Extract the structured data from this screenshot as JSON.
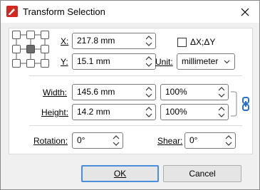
{
  "window": {
    "title": "Transform Selection"
  },
  "position": {
    "x_label": "X:",
    "x_value": "217.8 mm",
    "y_label": "Y:",
    "y_value": "15.1 mm",
    "delta_label": "ΔX;ΔY",
    "unit_label": "Unit:",
    "unit_value": "millimeter"
  },
  "size": {
    "width_label": "Width:",
    "width_value": "145.6 mm",
    "width_percent": "100%",
    "height_label": "Height:",
    "height_value": "14.2 mm",
    "height_percent": "100%"
  },
  "rotation": {
    "rotation_label": "Rotation:",
    "rotation_value": "0°",
    "shear_label": "Shear:",
    "shear_value": "0°"
  },
  "buttons": {
    "ok": "OK",
    "cancel": "Cancel"
  },
  "colors": {
    "accent": "#4a8fd8",
    "link": "#2a6fc7",
    "app_icon": "#d3281f"
  }
}
